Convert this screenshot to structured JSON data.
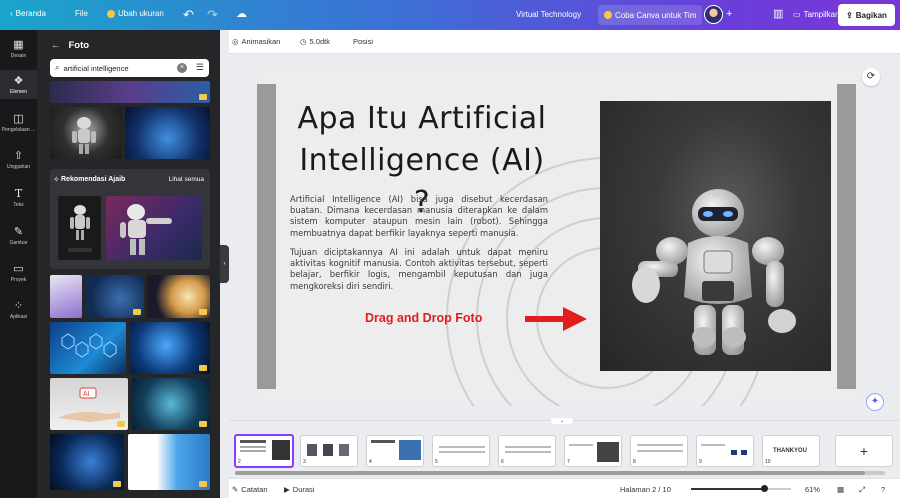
{
  "topbar": {
    "home_label": "Beranda",
    "file_label": "File",
    "resize_label": "Ubah ukuran",
    "doc_title": "Virtual Technology",
    "try_label": "Coba Canva untuk Tim",
    "present_label": "Tampilkan",
    "share_label": "Bagikan"
  },
  "rail": [
    {
      "label": "Desain",
      "icon": "layout-icon"
    },
    {
      "label": "Elemen",
      "icon": "elements-icon"
    },
    {
      "label": "Pengelolaan ...",
      "icon": "brand-icon"
    },
    {
      "label": "Unggahan",
      "icon": "upload-icon"
    },
    {
      "label": "Teks",
      "icon": "text-icon"
    },
    {
      "label": "Gambar",
      "icon": "draw-icon"
    },
    {
      "label": "Proyek",
      "icon": "folder-icon"
    },
    {
      "label": "Aplikasi",
      "icon": "apps-icon"
    }
  ],
  "panel": {
    "title": "Foto",
    "search_value": "artificial intelligence",
    "magic_title": "Rekomendasi Ajaib",
    "magic_see_all": "Lihat semua"
  },
  "context_toolbar": {
    "animate_label": "Animasikan",
    "duration_label": "5.0dtk",
    "position_label": "Posisi"
  },
  "slide": {
    "title": "Apa Itu Artificial Intelligence (AI) ?",
    "paragraph1": "Artificial Intelligence (AI) bisa juga disebut kecerdasan buatan. Dimana kecerdasan manusia diterapkan ke dalam sistem komputer ataupun mesin lain (robot). Sehingga membuatnya dapat berfikir layaknya seperti manusia.",
    "paragraph2": "Tujuan diciptakannya AI ini adalah untuk dapat meniru aktivitas kognitif manusia. Contoh aktivitas tersebut, seperti belajar, berfikir logis, mengambil keputusan dan juga mengkoreksi diri sendiri.",
    "annotation": "Drag and Drop Foto",
    "annotation_color": "#e21d1d"
  },
  "filmstrip": {
    "pages": [
      "2",
      "3",
      "4",
      "5",
      "6",
      "7",
      "8",
      "9",
      "10"
    ],
    "active_page": "2",
    "page9_text": "THANKYOU"
  },
  "bottombar": {
    "notes_label": "Catatan",
    "duration_label": "Durasi",
    "page_indicator": "Halaman 2 / 10",
    "zoom_label": "61%",
    "zoom_level": 0.61
  },
  "colors": {
    "accent": "#8b3dff",
    "panel_bg": "#252627",
    "rail_bg": "#18191b"
  }
}
